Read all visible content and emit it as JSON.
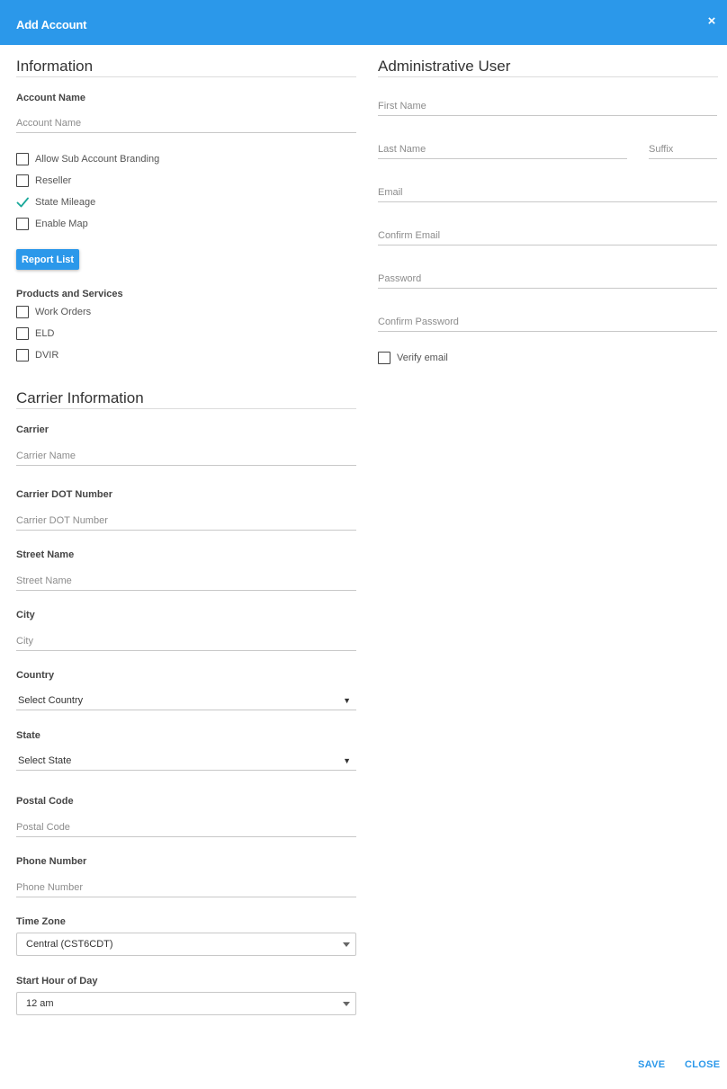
{
  "header": {
    "title": "Add Account",
    "close_icon": "×"
  },
  "information": {
    "title": "Information",
    "account_name": {
      "label": "Account Name",
      "placeholder": "Account Name"
    },
    "checkboxes": [
      {
        "label": "Allow Sub Account Branding",
        "checked": false
      },
      {
        "label": "Reseller",
        "checked": false
      },
      {
        "label": "State Mileage",
        "checked": true
      },
      {
        "label": "Enable Map",
        "checked": false
      }
    ],
    "report_list_button": "Report List",
    "products_title": "Products and Services",
    "products": [
      {
        "label": "Work Orders",
        "checked": false
      },
      {
        "label": "ELD",
        "checked": false
      },
      {
        "label": "DVIR",
        "checked": false
      }
    ]
  },
  "carrier": {
    "title": "Carrier Information",
    "carrier_name": {
      "label": "Carrier",
      "placeholder": "Carrier Name"
    },
    "dot_number": {
      "label": "Carrier DOT Number",
      "placeholder": "Carrier DOT Number"
    },
    "street": {
      "label": "Street Name",
      "placeholder": "Street Name"
    },
    "city": {
      "label": "City",
      "placeholder": "City"
    },
    "country": {
      "label": "Country",
      "value": "Select Country"
    },
    "state": {
      "label": "State",
      "value": "Select State"
    },
    "postal": {
      "label": "Postal Code",
      "placeholder": "Postal Code"
    },
    "phone": {
      "label": "Phone Number",
      "placeholder": "Phone Number"
    },
    "timezone": {
      "label": "Time Zone",
      "value": "Central (CST6CDT)"
    },
    "start_hour": {
      "label": "Start Hour of Day",
      "value": "12 am"
    }
  },
  "admin": {
    "title": "Administrative User",
    "first_name": {
      "placeholder": "First Name"
    },
    "last_name": {
      "placeholder": "Last Name"
    },
    "suffix": {
      "placeholder": "Suffix"
    },
    "email": {
      "placeholder": "Email"
    },
    "confirm_email": {
      "placeholder": "Confirm Email"
    },
    "password": {
      "placeholder": "Password"
    },
    "confirm_password": {
      "placeholder": "Confirm Password"
    },
    "verify_email": {
      "label": "Verify email",
      "checked": false
    }
  },
  "footer": {
    "save": "SAVE",
    "close": "CLOSE"
  },
  "colors": {
    "primary": "#2b98ea",
    "check": "#1aa89a"
  },
  "icons": {
    "dropdown": "▼"
  }
}
